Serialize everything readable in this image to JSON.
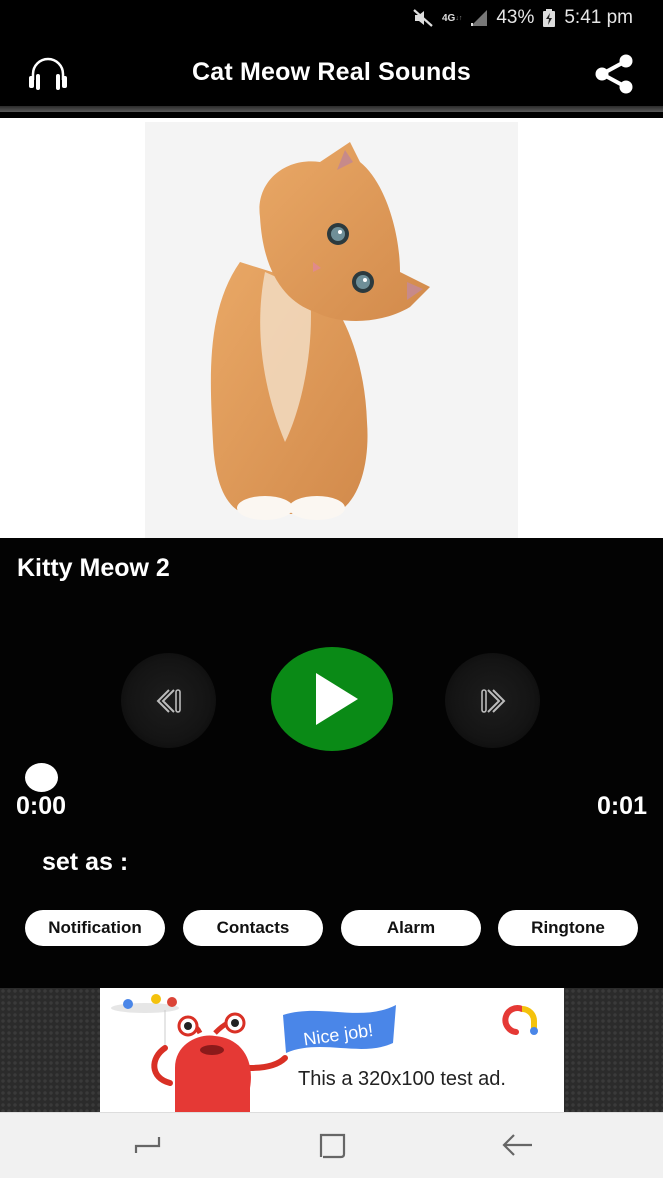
{
  "status_bar": {
    "network": "4G",
    "battery": "43%",
    "time": "5:41 pm",
    "icons": [
      "mute-icon",
      "network-4g-icon",
      "signal-icon",
      "battery-charging-icon"
    ]
  },
  "app_bar": {
    "title": "Cat Meow Real Sounds",
    "left_icon": "headphones-icon",
    "right_icon": "share-icon"
  },
  "image": {
    "subject": "orange kitten"
  },
  "player": {
    "track_title": "Kitty Meow 2",
    "current_time": "0:00",
    "total_time": "0:01",
    "progress": 0,
    "controls": {
      "prev_icon": "skip-previous-icon",
      "play_icon": "play-icon",
      "next_icon": "skip-next-icon"
    },
    "accent_color": "#0a8a16"
  },
  "set_as": {
    "label": "set as :",
    "buttons": [
      {
        "label": "Notification"
      },
      {
        "label": "Contacts"
      },
      {
        "label": "Alarm"
      },
      {
        "label": "Ringtone"
      }
    ]
  },
  "ad": {
    "flag_text": "Nice job!",
    "body_text": "This a 320x100 test ad."
  },
  "nav_bar": {
    "buttons": [
      "recents-icon",
      "home-icon",
      "back-icon"
    ]
  }
}
